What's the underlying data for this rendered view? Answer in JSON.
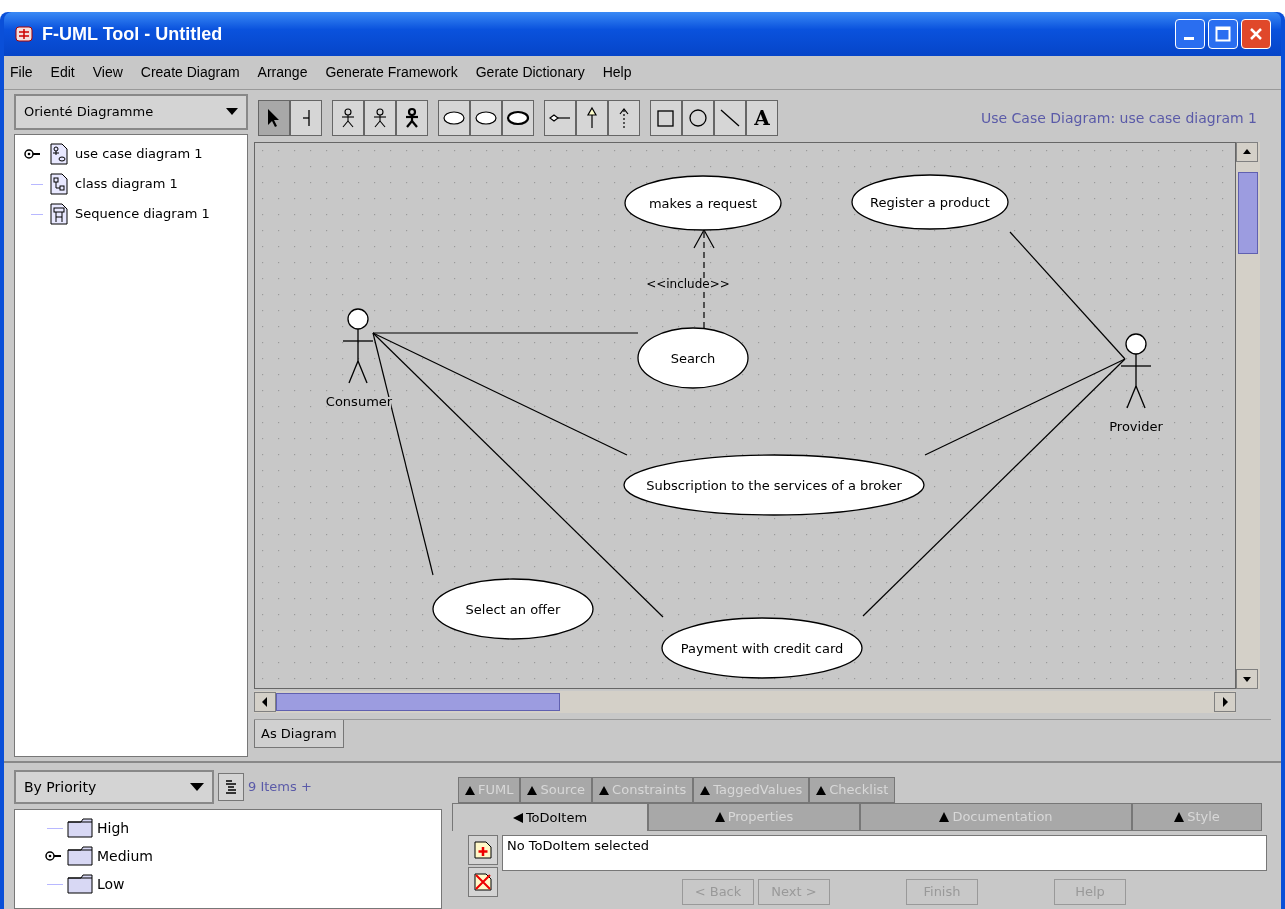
{
  "window": {
    "title": "F-UML Tool - Untitled"
  },
  "menu": [
    {
      "label": "File"
    },
    {
      "label": "Edit"
    },
    {
      "label": "View"
    },
    {
      "label": "Create Diagram"
    },
    {
      "label": "Arrange"
    },
    {
      "label": "Generate Framework"
    },
    {
      "label": "Gerate Dictionary"
    },
    {
      "label": "Help"
    }
  ],
  "navigator": {
    "perspective": "Orienté Diagramme",
    "tree": [
      {
        "label": "use case diagram 1",
        "kind": "usecase",
        "selected": true
      },
      {
        "label": "class diagram 1",
        "kind": "class",
        "selected": false
      },
      {
        "label": "Sequence diagram 1",
        "kind": "sequence",
        "selected": false
      }
    ]
  },
  "toolbar": {
    "groups": [
      [
        {
          "kind": "select",
          "selected": true
        },
        {
          "kind": "broom",
          "selected": false
        }
      ],
      [
        {
          "kind": "actor",
          "selected": false
        },
        {
          "kind": "actor-thin",
          "selected": false
        },
        {
          "kind": "actor-bold",
          "selected": false
        }
      ],
      [
        {
          "kind": "ellipse",
          "selected": false
        },
        {
          "kind": "ellipse-thin",
          "selected": false
        },
        {
          "kind": "ellipse-bold",
          "selected": false
        }
      ],
      [
        {
          "kind": "association",
          "selected": false
        },
        {
          "kind": "generalization",
          "selected": false
        },
        {
          "kind": "dependency",
          "selected": false
        }
      ],
      [
        {
          "kind": "rectangle",
          "selected": false
        },
        {
          "kind": "circle",
          "selected": false
        },
        {
          "kind": "line",
          "selected": false
        },
        {
          "kind": "text",
          "label": "A",
          "selected": false
        }
      ]
    ],
    "diagram_title": "Use Case Diagram: use case diagram 1"
  },
  "diagram": {
    "use_cases": [
      {
        "name": "makes a request"
      },
      {
        "name": "Register a product"
      },
      {
        "name": "Search"
      },
      {
        "name": "Subscription to the services of a broker"
      },
      {
        "name": "Select an offer"
      },
      {
        "name": "Payment with credit card"
      }
    ],
    "actors": [
      {
        "name": "Consumer"
      },
      {
        "name": "Provider"
      }
    ],
    "include_label": "<<include>>"
  },
  "view_tabs": [
    {
      "label": "As Diagram",
      "selected": true
    }
  ],
  "todo": {
    "grouping": "By Priority",
    "count": "9 Items +",
    "tree": [
      {
        "label": "High",
        "selected": false
      },
      {
        "label": "Medium",
        "selected": true
      },
      {
        "label": "Low",
        "selected": false
      }
    ]
  },
  "details": {
    "tabs_back": [
      {
        "label": "FUML"
      },
      {
        "label": "Source"
      },
      {
        "label": "Constraints"
      },
      {
        "label": "TaggedValues"
      },
      {
        "label": "Checklist"
      }
    ],
    "tabs_front": [
      {
        "label": "ToDoItem",
        "selected": true
      },
      {
        "label": "Properties",
        "selected": false
      },
      {
        "label": "Documentation",
        "selected": false
      },
      {
        "label": "Style",
        "selected": false
      }
    ],
    "message": "No ToDoItem selected",
    "buttons": [
      {
        "label": "< Back",
        "disabled": true
      },
      {
        "label": "Next >",
        "disabled": true
      },
      {
        "label": "Finish",
        "disabled": true
      },
      {
        "label": "Help",
        "disabled": true
      }
    ]
  }
}
